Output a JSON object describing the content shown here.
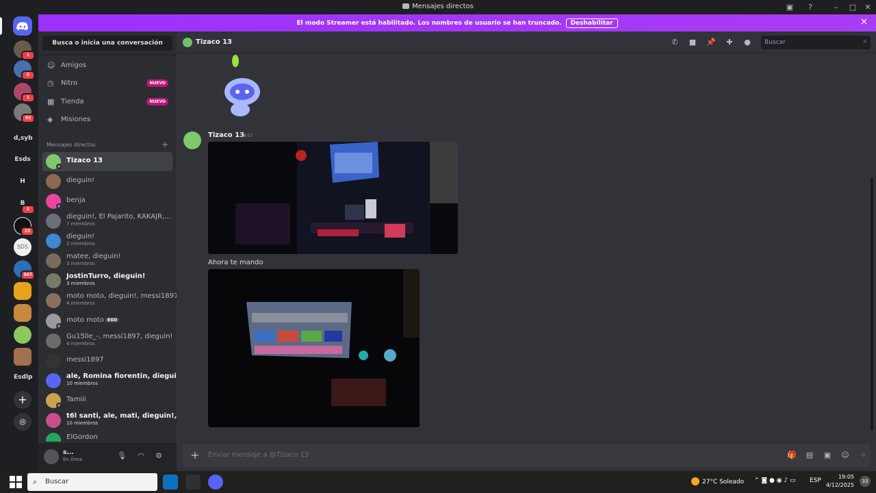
{
  "window": {
    "title": "Mensajes directos"
  },
  "banner": {
    "message": "El modo Streamer está habilitado. Los nombres de usuario se han truncado.",
    "button": "Deshabilitar"
  },
  "servers": {
    "items": [
      {
        "label": "",
        "badge": "1"
      },
      {
        "label": "",
        "badge": "5"
      },
      {
        "label": "",
        "badge": "1"
      },
      {
        "label": "",
        "badge": "93"
      },
      {
        "label": "d,syb",
        "badge": ""
      },
      {
        "label": "Esds",
        "badge": ""
      },
      {
        "label": "H",
        "badge": ""
      },
      {
        "label": "B",
        "badge": "2"
      },
      {
        "label": "",
        "badge": "23"
      },
      {
        "label": "SDS",
        "badge": ""
      },
      {
        "label": "",
        "badge": "567"
      },
      {
        "label": "",
        "badge": ""
      },
      {
        "label": "",
        "badge": ""
      },
      {
        "label": "",
        "badge": ""
      },
      {
        "label": "",
        "badge": ""
      },
      {
        "label": "Esdlp",
        "badge": ""
      }
    ]
  },
  "sidebar": {
    "search": "Busca o inicia una conversación",
    "nav": [
      {
        "label": "Amigos",
        "icon": "friends-icon",
        "badge": ""
      },
      {
        "label": "Nitro",
        "icon": "nitro-icon",
        "badge": "NUEVO"
      },
      {
        "label": "Tienda",
        "icon": "shop-icon",
        "badge": "NUEVO"
      },
      {
        "label": "Misiones",
        "icon": "quests-icon",
        "badge": ""
      }
    ],
    "dm_header": "Mensajes directos",
    "dms": [
      {
        "name": "Tizaco 13",
        "sub": ""
      },
      {
        "name": "dieguin!",
        "sub": ""
      },
      {
        "name": "benja",
        "sub": ""
      },
      {
        "name": "dieguin!, El Pajarito, KAKAJR,...",
        "sub": "7 miembros"
      },
      {
        "name": "dieguin!",
        "sub": "2 miembros"
      },
      {
        "name": "matee, dieguin!",
        "sub": "3 miembros"
      },
      {
        "name": "JostinTurro, dieguin!",
        "sub": "3 miembros"
      },
      {
        "name": "moto moto, dieguin!, messi1897",
        "sub": "4 miembros"
      },
      {
        "name": "moto moto",
        "sub": "",
        "tag": "EGO"
      },
      {
        "name": "Gu15lle_-, messi1897, dieguin!",
        "sub": "4 miembros"
      },
      {
        "name": "messi1897",
        "sub": ""
      },
      {
        "name": "ale, Romina fiorentin, dieguin!...",
        "sub": "10 miembros"
      },
      {
        "name": "Tamiii",
        "sub": ""
      },
      {
        "name": "t6l santi, ale, mati, dieguin!, m...",
        "sub": "10 miembros"
      },
      {
        "name": "ElGordon",
        "sub": ""
      }
    ]
  },
  "user": {
    "name": "s...",
    "status": "En línea"
  },
  "chat": {
    "recipient": "Tizaco 13",
    "search_placeholder": "Buscar",
    "author": "Tizaco 13",
    "time": "18:57",
    "caption": "Ahora te mando",
    "composer_placeholder": "Enviar mensaje a @Tizaco 13"
  },
  "taskbar": {
    "search": "Buscar",
    "weather": "27°C  Soleado",
    "lang": "ESP",
    "time": "19:05",
    "date": "4/12/2025",
    "notifications": "33"
  },
  "colors": {
    "accent": "#5865f2",
    "banner": "#a13af5",
    "badge_new": "#c2137a",
    "online": "#23a55a"
  }
}
